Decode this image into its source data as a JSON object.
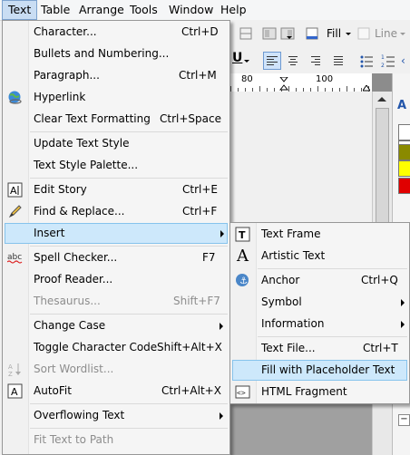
{
  "menubar": {
    "items": [
      "Text",
      "Table",
      "Arrange",
      "Tools",
      "Window",
      "Help"
    ]
  },
  "toolbar": {
    "fill_label": "Fill",
    "line_label": "Line"
  },
  "ruler": {
    "label_left": "80",
    "label_right": "100"
  },
  "text_menu": {
    "items": [
      {
        "label": "Character...",
        "shortcut": "Ctrl+D"
      },
      {
        "label": "Bullets and Numbering..."
      },
      {
        "label": "Paragraph...",
        "shortcut": "Ctrl+M"
      },
      {
        "label": "Hyperlink",
        "icon": "hyperlink-globe-icon"
      },
      {
        "label": "Clear Text Formatting",
        "shortcut": "Ctrl+Space"
      },
      {
        "label": "Update Text Style"
      },
      {
        "label": "Text Style Palette..."
      },
      {
        "label": "Edit Story",
        "shortcut": "Ctrl+E",
        "icon": "edit-story-icon"
      },
      {
        "label": "Find & Replace...",
        "shortcut": "Ctrl+F",
        "icon": "find-replace-pencil-icon"
      },
      {
        "label": "Insert",
        "submenu": true,
        "highlighted": true
      },
      {
        "label": "Spell Checker...",
        "shortcut": "F7",
        "icon": "spell-check-abc-icon"
      },
      {
        "label": "Proof Reader..."
      },
      {
        "label": "Thesaurus...",
        "shortcut": "Shift+F7",
        "disabled": true
      },
      {
        "label": "Change Case",
        "submenu": true
      },
      {
        "label": "Toggle Character Code",
        "shortcut": "Shift+Alt+X"
      },
      {
        "label": "Sort Wordlist...",
        "disabled": true,
        "icon": "sort-az-icon"
      },
      {
        "label": "AutoFit",
        "shortcut": "Ctrl+Alt+X",
        "icon": "autofit-icon"
      },
      {
        "label": "Overflowing Text",
        "submenu": true
      },
      {
        "label": "Fit Text to Path",
        "disabled": true
      }
    ]
  },
  "insert_submenu": {
    "items": [
      {
        "label": "Text Frame",
        "icon": "text-frame-icon"
      },
      {
        "label": "Artistic Text",
        "icon": "artistic-text-icon"
      },
      {
        "label": "Anchor",
        "shortcut": "Ctrl+Q",
        "icon": "anchor-icon"
      },
      {
        "label": "Symbol",
        "submenu": true
      },
      {
        "label": "Information",
        "submenu": true
      },
      {
        "label": "Text File...",
        "shortcut": "Ctrl+T"
      },
      {
        "label": "Fill with Placeholder Text",
        "highlighted": true
      },
      {
        "label": "HTML Fragment",
        "icon": "html-fragment-icon"
      }
    ]
  },
  "colors": {
    "menu_highlight": "#cde8fb",
    "menu_highlight_border": "#86c3ec",
    "menubar_active": "#c9ddf3",
    "swatch_olive": "#8a8a00",
    "swatch_yellow": "#ffff00",
    "swatch_red": "#e00000",
    "canvas_gray": "#a0a0a0"
  }
}
